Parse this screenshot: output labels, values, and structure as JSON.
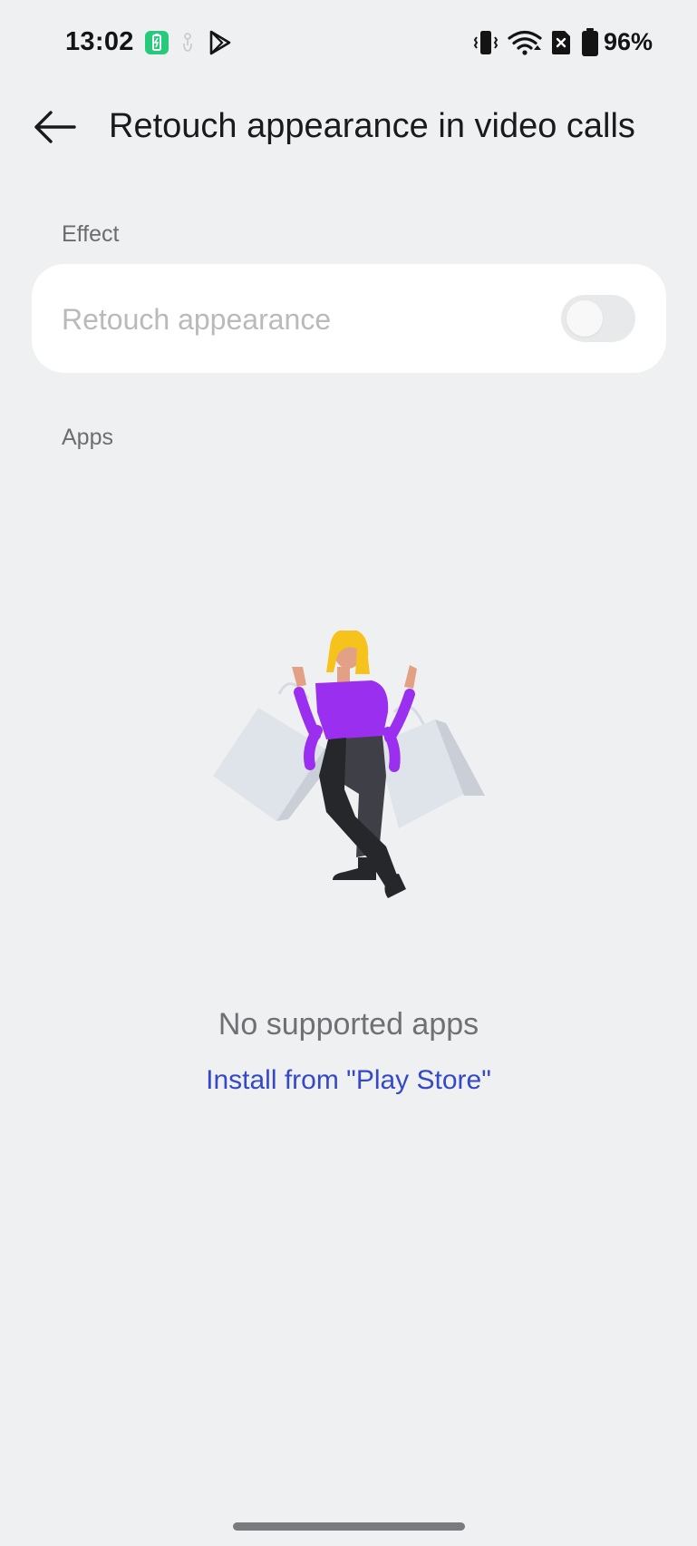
{
  "status_bar": {
    "time": "13:02",
    "battery_percent": "96%",
    "icons": [
      "battery-saver-icon",
      "touch-icon",
      "play-store-icon",
      "vibrate-icon",
      "wifi-icon",
      "no-sim-icon",
      "battery-icon"
    ]
  },
  "header": {
    "back_icon": "arrow-left-icon",
    "title": "Retouch appearance in video calls"
  },
  "effect_section": {
    "label": "Effect",
    "toggle": {
      "label": "Retouch appearance",
      "state": "off",
      "enabled": false
    }
  },
  "apps_section": {
    "label": "Apps",
    "empty_state": {
      "illustration": "woman-with-shopping-bags",
      "message": "No supported apps",
      "action_label": "Install from \"Play Store\""
    }
  },
  "colors": {
    "background": "#eff0f2",
    "card": "#ffffff",
    "link": "#3549c8",
    "accent_green": "#27c97a",
    "figure_purple": "#9b2ff0",
    "figure_hair": "#f6c21c"
  }
}
